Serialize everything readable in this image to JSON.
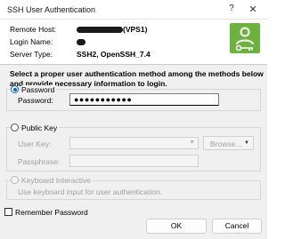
{
  "window": {
    "title": "SSH User Authentication",
    "help_glyph": "?",
    "close_glyph": "✕"
  },
  "info": {
    "remote_host_label": "Remote Host:",
    "remote_host_suffix": "(VPS1)",
    "login_name_label": "Login Name:",
    "server_type_label": "Server Type:",
    "server_type_value": "SSH2, OpenSSH_7.4"
  },
  "instructions": "Select a proper user authentication method among the methods below and provide necessary information to login.",
  "password_method": {
    "label": "Password",
    "field_label": "Password:",
    "value": "●●●●●●●●●●●",
    "checked": true
  },
  "public_key_method": {
    "label": "Public Key",
    "user_key_label": "User Key:",
    "passphrase_label": "Passphrase:",
    "browse_label": "Browse...",
    "checked": false
  },
  "keyboard_method": {
    "label": "Keyboard Interactive",
    "description": "Use keyboard input for user authentication."
  },
  "remember_password": {
    "label": "Remember Password",
    "checked": false
  },
  "buttons": {
    "ok": "OK",
    "cancel": "Cancel"
  },
  "colors": {
    "accent": "#0066cc",
    "logo_green": "#6cb33e"
  },
  "icons": {
    "logo": "user-key-icon",
    "help": "help-icon",
    "close": "close-icon"
  }
}
